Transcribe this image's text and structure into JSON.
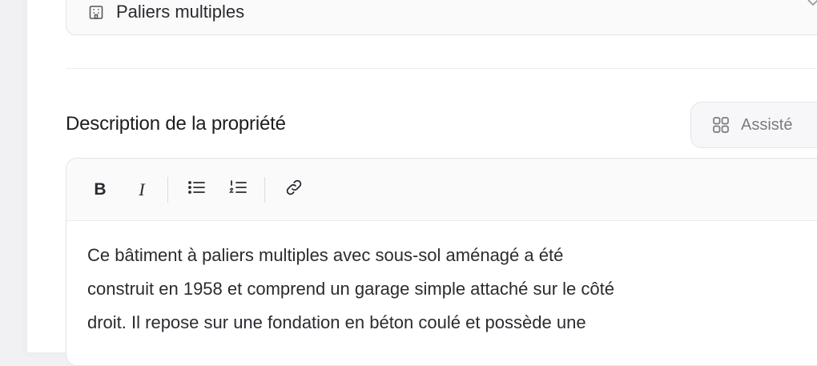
{
  "property_type": {
    "value": "Paliers multiples",
    "icon": "building-icon"
  },
  "description": {
    "title": "Description de la propriété",
    "assist_label": "Assisté",
    "assist_icon": "grid-icon"
  },
  "toolbar": {
    "bold": "B",
    "italic": "I",
    "icons": [
      "bullet-list-icon",
      "numbered-list-icon",
      "link-icon"
    ]
  },
  "editor": {
    "lines": [
      "Ce bâtiment à paliers multiples avec sous-sol aménagé a été",
      "construit en 1958 et comprend un garage simple attaché sur le côté",
      "droit. Il repose sur une fondation en béton coulé et possède une"
    ]
  }
}
